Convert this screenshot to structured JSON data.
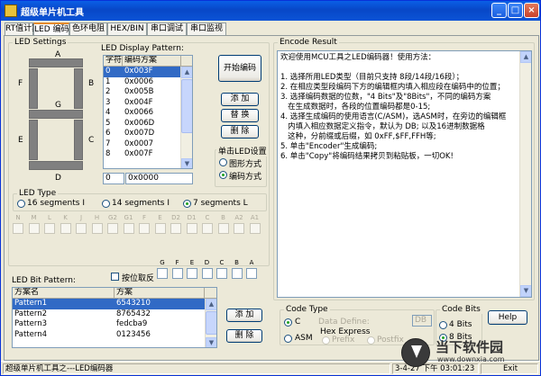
{
  "window": {
    "title": "超级单片机工具",
    "min_label": "_",
    "max_label": "□",
    "close_label": "×"
  },
  "tabs": [
    "RT值计算",
    "LED 编码",
    "色环电阻",
    "HEX/BIN",
    "串口调试",
    "串口监视"
  ],
  "led_settings": {
    "caption": "LED Settings",
    "segment_labels": [
      "A",
      "B",
      "C",
      "D",
      "E",
      "F",
      "G"
    ]
  },
  "display_pattern": {
    "caption": "LED Display Pattern:",
    "columns": [
      "字符",
      "编码方案"
    ],
    "rows": [
      [
        "0",
        "0x003F"
      ],
      [
        "1",
        "0x0006"
      ],
      [
        "2",
        "0x005B"
      ],
      [
        "3",
        "0x004F"
      ],
      [
        "4",
        "0x0066"
      ],
      [
        "5",
        "0x006D"
      ],
      [
        "6",
        "0x007D"
      ],
      [
        "7",
        "0x0007"
      ],
      [
        "8",
        "0x007F"
      ]
    ],
    "selected_index": 0,
    "char_value": "0",
    "code_value": "0x0000"
  },
  "buttons": {
    "start": "开始编码",
    "add": "添 加",
    "replace": "替 换",
    "delete": "删 除",
    "add2": "添 加",
    "delete2": "删 除",
    "help": "Help"
  },
  "single_led": {
    "caption": "单击LED设置",
    "options": [
      "图形方式",
      "编码方式"
    ],
    "selected": 1
  },
  "led_type": {
    "caption": "LED Type",
    "options": [
      "16 segments I",
      "14 segments I",
      "7 segments L"
    ],
    "selected": 2
  },
  "bits_row1": [
    "N",
    "M",
    "L",
    "K",
    "J",
    "H",
    "G2",
    "G1",
    "F",
    "E",
    "D2",
    "D1",
    "C",
    "B",
    "A2",
    "A1"
  ],
  "bits_row2": [
    "G",
    "F",
    "E",
    "D",
    "C",
    "B",
    "A"
  ],
  "bit_pattern": {
    "caption": "LED Bit Pattern:",
    "reverse_label": "按位取反",
    "columns": [
      "方案名",
      "方案"
    ],
    "rows": [
      [
        "Pattern1",
        "6543210"
      ],
      [
        "Pattern2",
        "8765432"
      ],
      [
        "Pattern3",
        "fedcba9"
      ],
      [
        "Pattern4",
        "0123456"
      ]
    ],
    "selected_index": 0
  },
  "encode_result": {
    "caption": "Encode Result",
    "lines": [
      "欢迎使用MCU工具之LED编码器！使用方法：",
      "",
      "1. 选择所用LED类型（目前只支持 8段/14段/16段）；",
      "2. 在相应类型段编码下方的编辑框内填入相应段在编码中的位置；",
      "3. 选择编码数据的位数，\"4 Bits\"及\"8Bits\"，不同的编码方案",
      "   在生成数据时，各段的位置编码都是0-15;",
      "4. 选择生成编码的使用语言(C/ASM)，选ASM时，在旁边的编辑框",
      "   内填入相应数据定义指令，默认为 DB; 以及16进制数据格",
      "   这种，分前缀或后缀，如 0xFF,$FF,FFH等;",
      "5. 单击\"Encoder\"生成编码;",
      "6. 单击\"Copy\"将编码结果拷贝到粘贴板，一切OK!"
    ]
  },
  "code_type": {
    "caption": "Code Type",
    "options": [
      "C",
      "ASM"
    ],
    "selected": 0,
    "data_define_label": "Data Define:",
    "data_define_value": "DB",
    "hex_express_label": "Hex Express",
    "hex_options": [
      "Prefix",
      "Postfix"
    ]
  },
  "code_bits": {
    "caption": "Code Bits",
    "options": [
      "4 Bits",
      "8 Bits"
    ],
    "selected": 1
  },
  "status": {
    "left": "超级单片机工具之---LED编码器",
    "time": "3-4-27 下午 03:01:23",
    "exit": "Exit"
  },
  "watermark": {
    "title": "当下软件园",
    "url": "www.downxia.com"
  }
}
